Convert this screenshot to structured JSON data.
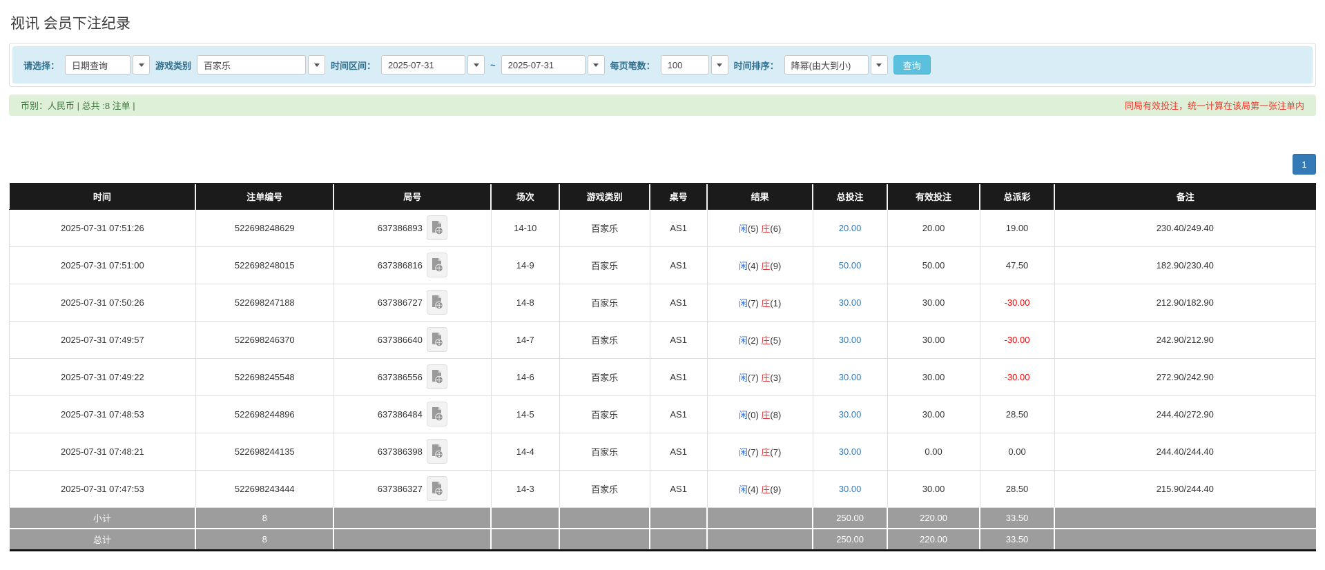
{
  "page": {
    "title": "视讯 会员下注纪录"
  },
  "colors": {
    "filter_bar_bg": "#d9edf7",
    "filter_label": "#31708f",
    "search_button": "#5bc0de",
    "summary_bg": "#dff0d8",
    "summary_text_green": "#3c763d",
    "summary_text_red": "#f03b2e",
    "header_bg": "#1b1b1b",
    "footer_bg": "#9d9d9d",
    "link_blue": "#337ab7",
    "player_blue": "#2e6dd9",
    "banker_red": "#e4393c",
    "negative_red": "#ff0000",
    "pagination_blue": "#337ab7"
  },
  "filters": {
    "select_label": "请选择：",
    "select_value": "日期查询",
    "game_label": "游戏类别",
    "game_value": "百家乐",
    "range_label": "时间区间：",
    "date_from": "2025-07-31",
    "tilde": "~",
    "date_to": "2025-07-31",
    "per_page_label": "每页笔数：",
    "per_page_value": "100",
    "sort_label": "时间排序：",
    "sort_value": "降幂(由大到小)",
    "search_button": "查询"
  },
  "summary": {
    "left": "币别：人民币 | 总共 :8 注单 |",
    "right": "同局有效投注，统一计算在该局第一张注单内"
  },
  "pagination": {
    "pages": [
      "1"
    ]
  },
  "table": {
    "headers": [
      "时间",
      "注单编号",
      "局号",
      "场次",
      "游戏类别",
      "桌号",
      "结果",
      "总投注",
      "有效投注",
      "总派彩",
      "备注"
    ],
    "rows": [
      {
        "time": "2025-07-31 07:51:26",
        "bet_no": "522698248629",
        "round_no": "637386893",
        "session": "14-10",
        "game": "百家乐",
        "table_no": "AS1",
        "rp": "闲",
        "rpn": "(5)",
        "rb": "庄",
        "rbn": "(6)",
        "total_bet": "20.00",
        "valid_bet": "20.00",
        "payout": "19.00",
        "note": "230.40/249.40"
      },
      {
        "time": "2025-07-31 07:51:00",
        "bet_no": "522698248015",
        "round_no": "637386816",
        "session": "14-9",
        "game": "百家乐",
        "table_no": "AS1",
        "rp": "闲",
        "rpn": "(4)",
        "rb": "庄",
        "rbn": "(9)",
        "total_bet": "50.00",
        "valid_bet": "50.00",
        "payout": "47.50",
        "note": "182.90/230.40"
      },
      {
        "time": "2025-07-31 07:50:26",
        "bet_no": "522698247188",
        "round_no": "637386727",
        "session": "14-8",
        "game": "百家乐",
        "table_no": "AS1",
        "rp": "闲",
        "rpn": "(7)",
        "rb": "庄",
        "rbn": "(1)",
        "total_bet": "30.00",
        "valid_bet": "30.00",
        "payout": "-30.00",
        "note": "212.90/182.90"
      },
      {
        "time": "2025-07-31 07:49:57",
        "bet_no": "522698246370",
        "round_no": "637386640",
        "session": "14-7",
        "game": "百家乐",
        "table_no": "AS1",
        "rp": "闲",
        "rpn": "(2)",
        "rb": "庄",
        "rbn": "(5)",
        "total_bet": "30.00",
        "valid_bet": "30.00",
        "payout": "-30.00",
        "note": "242.90/212.90"
      },
      {
        "time": "2025-07-31 07:49:22",
        "bet_no": "522698245548",
        "round_no": "637386556",
        "session": "14-6",
        "game": "百家乐",
        "table_no": "AS1",
        "rp": "闲",
        "rpn": "(7)",
        "rb": "庄",
        "rbn": "(3)",
        "total_bet": "30.00",
        "valid_bet": "30.00",
        "payout": "-30.00",
        "note": "272.90/242.90"
      },
      {
        "time": "2025-07-31 07:48:53",
        "bet_no": "522698244896",
        "round_no": "637386484",
        "session": "14-5",
        "game": "百家乐",
        "table_no": "AS1",
        "rp": "闲",
        "rpn": "(0)",
        "rb": "庄",
        "rbn": "(8)",
        "total_bet": "30.00",
        "valid_bet": "30.00",
        "payout": "28.50",
        "note": "244.40/272.90"
      },
      {
        "time": "2025-07-31 07:48:21",
        "bet_no": "522698244135",
        "round_no": "637386398",
        "session": "14-4",
        "game": "百家乐",
        "table_no": "AS1",
        "rp": "闲",
        "rpn": "(7)",
        "rb": "庄",
        "rbn": "(7)",
        "total_bet": "30.00",
        "valid_bet": "0.00",
        "payout": "0.00",
        "note": "244.40/244.40"
      },
      {
        "time": "2025-07-31 07:47:53",
        "bet_no": "522698243444",
        "round_no": "637386327",
        "session": "14-3",
        "game": "百家乐",
        "table_no": "AS1",
        "rp": "闲",
        "rpn": "(4)",
        "rb": "庄",
        "rbn": "(9)",
        "total_bet": "30.00",
        "valid_bet": "30.00",
        "payout": "28.50",
        "note": "215.90/244.40"
      }
    ],
    "subtotal": {
      "label": "小计",
      "count": "8",
      "total_bet": "250.00",
      "valid_bet": "220.00",
      "payout": "33.50"
    },
    "total": {
      "label": "总计",
      "count": "8",
      "total_bet": "250.00",
      "valid_bet": "220.00",
      "payout": "33.50"
    }
  }
}
